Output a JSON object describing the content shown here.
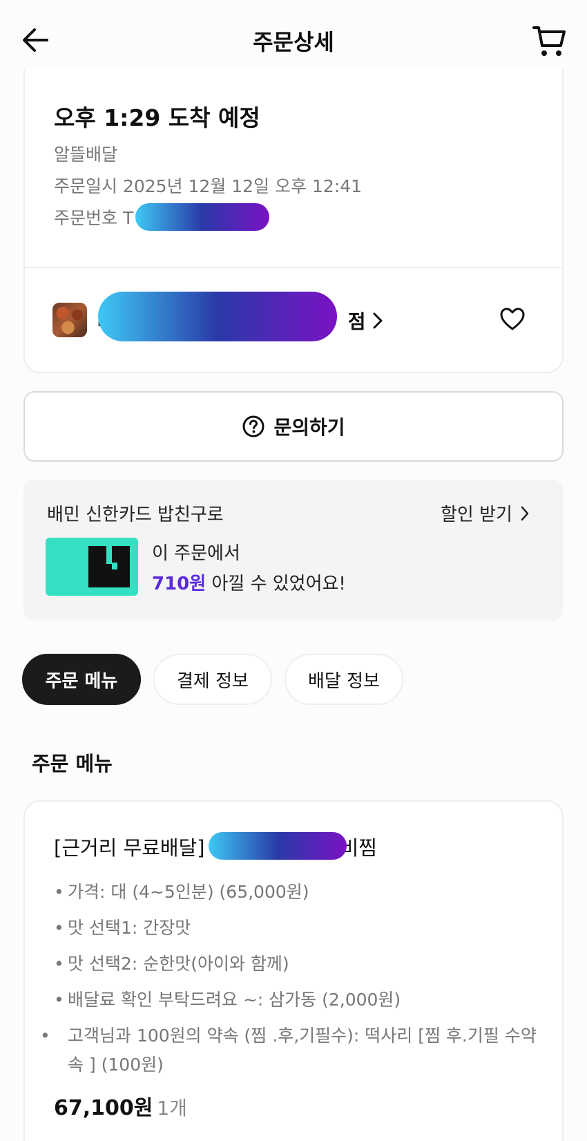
{
  "header": {
    "title": "주문상세",
    "back_icon": "arrow-left-icon",
    "cart_icon": "cart-icon"
  },
  "order": {
    "eta": "오후 1:29 도착 예정",
    "delivery_type": "알뜰배달",
    "order_datetime": "주문일시 2025년 12월 12일 오후 12:41",
    "order_number_prefix": "주문번호 T",
    "store_name_start": "ㅂ",
    "store_name_end": "점",
    "favorite_icon": "heart-icon"
  },
  "inquiry": {
    "label": "문의하기",
    "icon": "question-circle-icon"
  },
  "promo": {
    "title": "배민 신한카드 밥친구로",
    "link_label": "할인 받기",
    "line1": "이 주문에서",
    "amount": "710원",
    "line2_rest": " 아낄 수 있었어요!",
    "accent_color": "#5b2ad9"
  },
  "tabs": [
    {
      "label": "주문 메뉴",
      "active": true
    },
    {
      "label": "결제 정보",
      "active": false
    },
    {
      "label": "배달 정보",
      "active": false
    }
  ],
  "menu_section": {
    "title": "주문 메뉴",
    "item": {
      "name_prefix": "[근거리 무료배달]",
      "name_suffix": "비찜",
      "options": [
        "가격: 대 (4~5인분) (65,000원)",
        "맛 선택1: 간장맛",
        "맛 선택2: 순한맛(아이와 함께)",
        "배달료 확인 부탁드려요 ~: 삼가동 (2,000원)",
        "고객님과 100원의 약속 (찜 .후,기필수): 떡사리 [찜 후.기필 수약속 ] (100원)"
      ],
      "price": "67,100원",
      "quantity": "1개"
    }
  }
}
